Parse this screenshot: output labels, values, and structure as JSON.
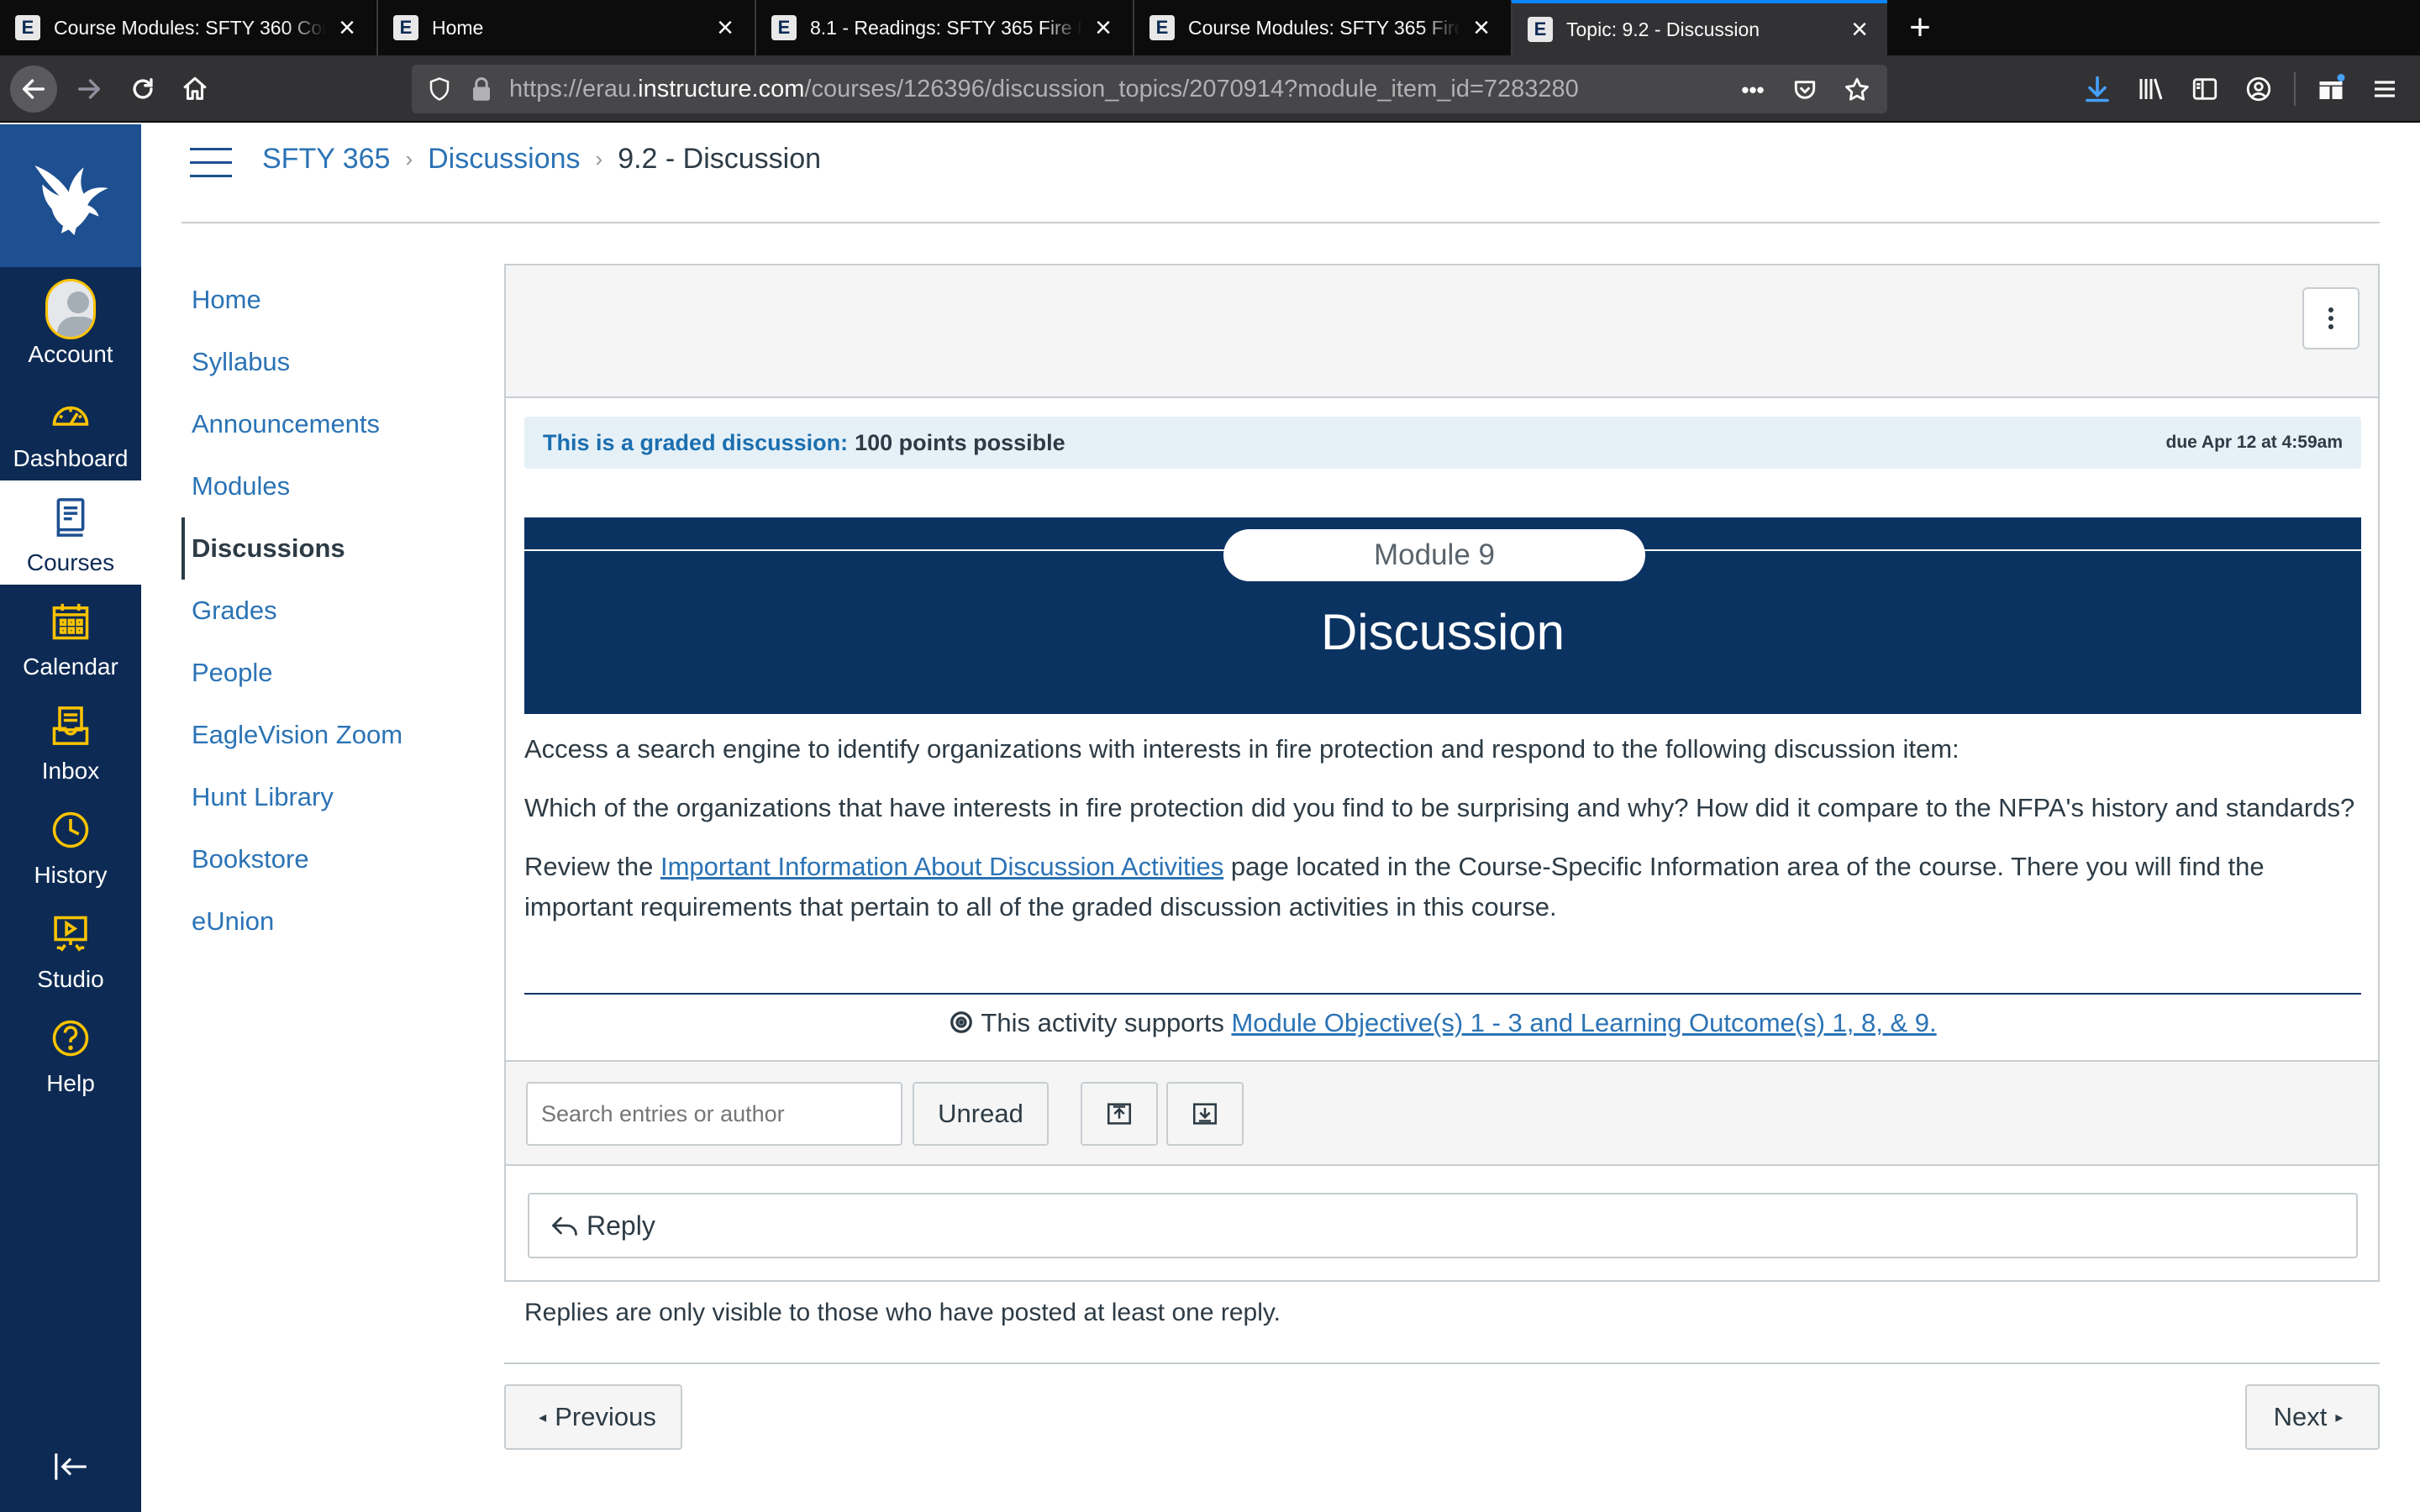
{
  "browser": {
    "tabs": [
      {
        "title": "Course Modules: SFTY 360 Con"
      },
      {
        "title": "Home"
      },
      {
        "title": "8.1 - Readings: SFTY 365 Fire P"
      },
      {
        "title": "Course Modules: SFTY 365 Fire"
      },
      {
        "title": "Topic: 9.2 - Discussion"
      }
    ],
    "tab_favicon": "E",
    "url_prefix": "https://erau.",
    "url_host": "instructure.com",
    "url_path": "/courses/126396/discussion_topics/2070914?module_item_id=7283280",
    "more_label": "•••"
  },
  "global_nav": {
    "items": [
      {
        "label": "Account",
        "icon": "account-avatar-icon"
      },
      {
        "label": "Dashboard",
        "icon": "dashboard-icon"
      },
      {
        "label": "Courses",
        "icon": "courses-icon"
      },
      {
        "label": "Calendar",
        "icon": "calendar-icon"
      },
      {
        "label": "Inbox",
        "icon": "inbox-icon"
      },
      {
        "label": "History",
        "icon": "clock-icon"
      },
      {
        "label": "Studio",
        "icon": "studio-icon"
      },
      {
        "label": "Help",
        "icon": "help-icon"
      }
    ],
    "active": "Courses",
    "colors": {
      "nav_bg": "#0c2a54",
      "logo_bg": "#1d4f91",
      "accent": "#fbc300"
    }
  },
  "breadcrumb": {
    "course": "SFTY 365",
    "section": "Discussions",
    "current": "9.2 - Discussion",
    "separator": "›"
  },
  "course_nav": {
    "items": [
      "Home",
      "Syllabus",
      "Announcements",
      "Modules",
      "Discussions",
      "Grades",
      "People",
      "EagleVision Zoom",
      "Hunt Library",
      "Bookstore",
      "eUnion"
    ],
    "active": "Discussions"
  },
  "topic": {
    "graded_label": "This is a graded discussion:",
    "points": "100 points possible",
    "due": "due Apr 12 at 4:59am",
    "banner_pill": "Module 9",
    "banner_title": "Discussion",
    "paragraph1": "Access a search engine to identify organizations with interests in fire protection and respond to the following discussion item:",
    "paragraph2": "Which of the organizations that have interests in fire protection did you find to be surprising and why? How did it compare to the NFPA's history and standards?",
    "paragraph3_before": "Review the ",
    "paragraph3_link": "Important Information About Discussion Activities",
    "paragraph3_after": " page located in the Course-Specific Information area of the course. There you will find the important requirements that pertain to all of the graded discussion activities in this course.",
    "objective_prefix": " This activity supports ",
    "objective_link": "Module Objective(s) 1 - 3 and Learning Outcome(s) 1, 8, & 9."
  },
  "toolbar": {
    "search_placeholder": "Search entries or author",
    "unread_label": "Unread"
  },
  "reply": {
    "label": "Reply"
  },
  "replies_note": "Replies are only visible to those who have posted at least one reply.",
  "pager": {
    "previous": "Previous",
    "next": "Next"
  }
}
